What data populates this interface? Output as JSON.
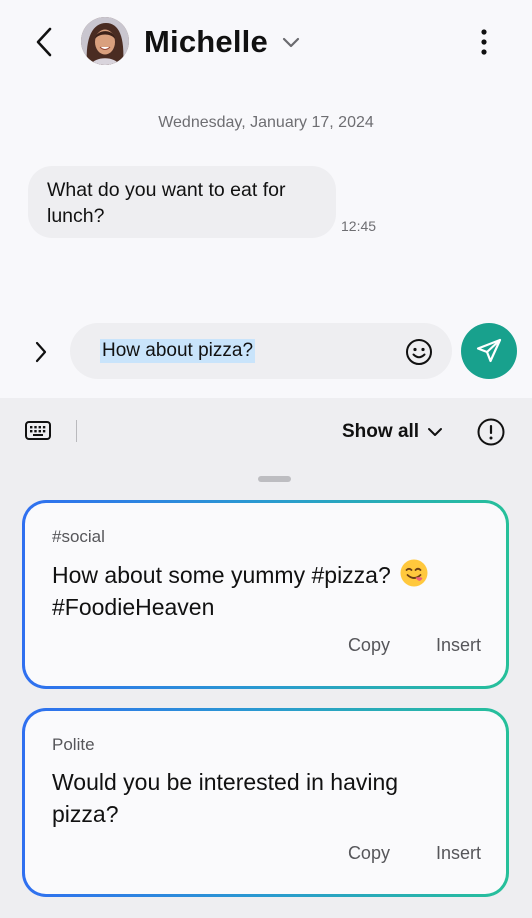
{
  "header": {
    "contact_name": "Michelle"
  },
  "conversation": {
    "date": "Wednesday, January 17, 2024",
    "messages": [
      {
        "text": "What do you want to eat for lunch?",
        "time": "12:45"
      }
    ]
  },
  "composer": {
    "text": "How about pizza?"
  },
  "suggestions_panel": {
    "show_all_label": "Show all",
    "cards": [
      {
        "tag": "#social",
        "text": "How about some yummy #pizza?",
        "text_line2": "#FoodieHeaven",
        "emoji": "face-savoring-food-emoji",
        "copy_label": "Copy",
        "insert_label": "Insert"
      },
      {
        "tag": "Polite",
        "text": "Would you be interested in having pizza?",
        "copy_label": "Copy",
        "insert_label": "Insert"
      }
    ]
  },
  "icons": {
    "back": "chevron-left-icon",
    "dropdown": "chevron-down-icon",
    "more": "more-vertical-icon",
    "expand": "chevron-right-icon",
    "emoji": "smiley-icon",
    "send": "send-icon",
    "keyboard": "keyboard-icon",
    "info": "info-icon"
  },
  "colors": {
    "send_button": "#18a18d",
    "selection_highlight": "#c9e4fb",
    "card_gradient_start": "#2f6ff0",
    "card_gradient_end": "#26c09a"
  }
}
